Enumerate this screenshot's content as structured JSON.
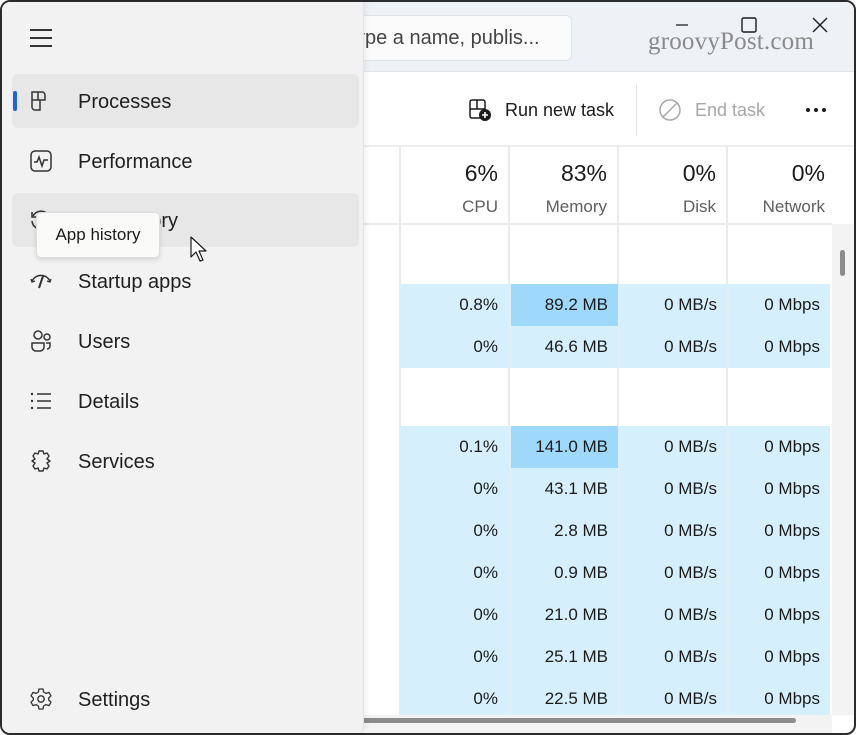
{
  "titlebar": {
    "search_placeholder": "Type a name, publis...",
    "search_visible_text": "ype a name, publis...",
    "watermark": "groovyPost.com",
    "controls": [
      "minimize",
      "maximize",
      "close"
    ]
  },
  "toolbar": {
    "run_new_task": "Run new task",
    "end_task": "End task",
    "more_icon": "more-horizontal-icon"
  },
  "nav": {
    "menu_icon": "hamburger-icon",
    "items": [
      {
        "label": "Processes",
        "icon": "processes-icon",
        "selected": true
      },
      {
        "label": "Performance",
        "icon": "performance-icon"
      },
      {
        "label": "App history",
        "icon": "app-history-icon",
        "hovered": true
      },
      {
        "label": "Startup apps",
        "icon": "startup-apps-icon"
      },
      {
        "label": "Users",
        "icon": "users-icon"
      },
      {
        "label": "Details",
        "icon": "details-icon"
      },
      {
        "label": "Services",
        "icon": "services-icon"
      }
    ],
    "settings": {
      "label": "Settings",
      "icon": "gear-icon"
    },
    "tooltip": "App history",
    "accent": "#1f64d8"
  },
  "columns": [
    {
      "percent": "6%",
      "label": "CPU"
    },
    {
      "percent": "83%",
      "label": "Memory"
    },
    {
      "percent": "0%",
      "label": "Disk"
    },
    {
      "percent": "0%",
      "label": "Network"
    }
  ],
  "rows": [
    {
      "cpu": "0.8%",
      "memory": "89.2 MB",
      "disk": "0 MB/s",
      "network": "0 Mbps",
      "mem_hot": true
    },
    {
      "cpu": "0%",
      "memory": "46.6 MB",
      "disk": "0 MB/s",
      "network": "0 Mbps"
    },
    {
      "cpu": "0.1%",
      "memory": "141.0 MB",
      "disk": "0 MB/s",
      "network": "0 Mbps",
      "mem_hot": true
    },
    {
      "cpu": "0%",
      "memory": "43.1 MB",
      "disk": "0 MB/s",
      "network": "0 Mbps"
    },
    {
      "cpu": "0%",
      "memory": "2.8 MB",
      "disk": "0 MB/s",
      "network": "0 Mbps"
    },
    {
      "cpu": "0%",
      "memory": "0.9 MB",
      "disk": "0 MB/s",
      "network": "0 Mbps"
    },
    {
      "cpu": "0%",
      "memory": "21.0 MB",
      "disk": "0 MB/s",
      "network": "0 Mbps"
    },
    {
      "cpu": "0%",
      "memory": "25.1 MB",
      "disk": "0 MB/s",
      "network": "0 Mbps"
    },
    {
      "cpu": "0%",
      "memory": "22.5 MB",
      "disk": "0 MB/s",
      "network": "0 Mbps"
    }
  ],
  "colors": {
    "row_highlight": "#d5effc",
    "memory_hot": "#9ed8fa"
  }
}
